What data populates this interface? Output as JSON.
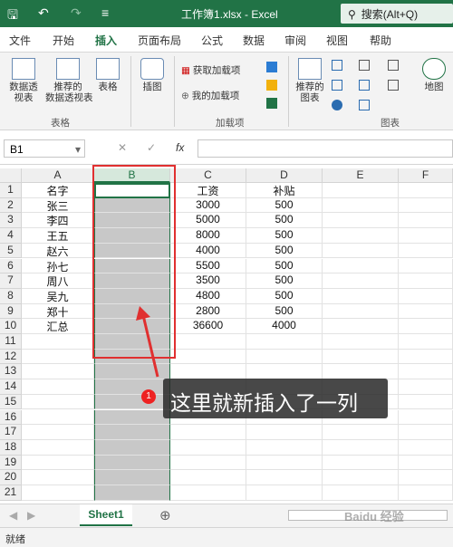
{
  "titlebar": {
    "title": "工作簿1.xlsx  -  Excel",
    "search": "搜索(Alt+Q)",
    "bg_color": "#217346"
  },
  "tabs": [
    "文件",
    "开始",
    "插入",
    "页面布局",
    "公式",
    "数据",
    "审阅",
    "视图",
    "帮助"
  ],
  "active_tab": "插入",
  "ribbon": {
    "pivot": "数据透\n视表",
    "recommended_pivot": "推荐的\n数据透视表",
    "table": "表格",
    "group_tables": "表格",
    "illustrations": "插图",
    "get_addins": "获取加载项",
    "my_addins": "我的加载项",
    "group_addins": "加载项",
    "recommended_charts": "推荐的\n图表",
    "group_charts": "图表",
    "maps": "地图"
  },
  "formula_bar": {
    "name_box": "B1",
    "fx": "fx",
    "value": ""
  },
  "columns": [
    "A",
    "B",
    "C",
    "D",
    "E",
    "F"
  ],
  "rows": [
    "1",
    "2",
    "3",
    "4",
    "5",
    "6",
    "7",
    "8",
    "9",
    "10",
    "11",
    "12",
    "13",
    "14",
    "15",
    "16",
    "17",
    "18",
    "19",
    "20",
    "21"
  ],
  "sheet": {
    "A": [
      "名字",
      "张三",
      "李四",
      "王五",
      "赵六",
      "孙七",
      "周八",
      "吴九",
      "郑十",
      "汇总"
    ],
    "C": [
      "工资",
      "3000",
      "5000",
      "8000",
      "4000",
      "5500",
      "3500",
      "4800",
      "2800",
      "36600"
    ],
    "D": [
      "补贴",
      "500",
      "500",
      "500",
      "500",
      "500",
      "500",
      "500",
      "500",
      "4000"
    ]
  },
  "sheet_tab": "Sheet1",
  "status": "就绪",
  "annotation": {
    "badge": "1",
    "text": "这里就新插入了一列"
  },
  "watermark": "Baidu 经验"
}
